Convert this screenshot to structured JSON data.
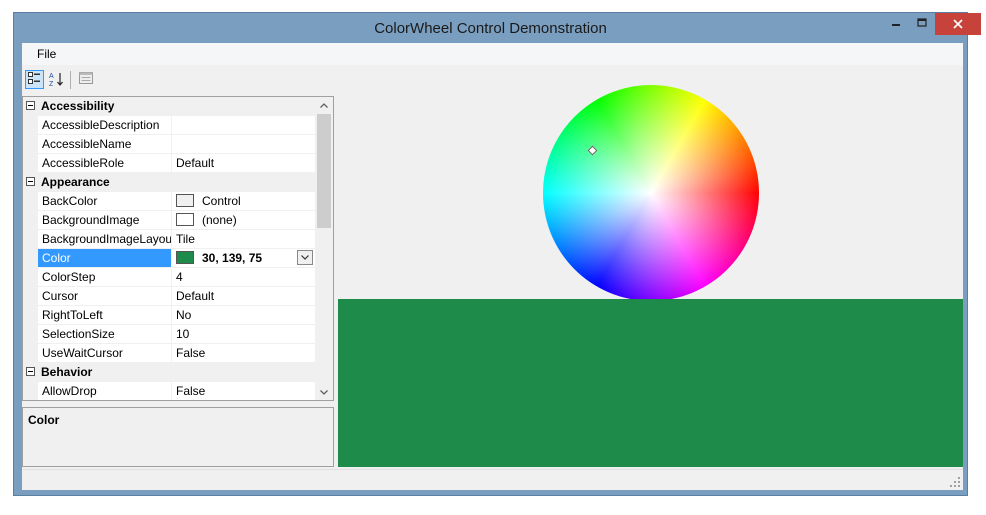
{
  "window": {
    "title": "ColorWheel Control Demonstration"
  },
  "menu": {
    "file": "File"
  },
  "property_grid": {
    "categories": {
      "accessibility": "Accessibility",
      "appearance": "Appearance",
      "behavior": "Behavior"
    },
    "rows": {
      "accessible_description": {
        "name": "AccessibleDescription",
        "value": ""
      },
      "accessible_name": {
        "name": "AccessibleName",
        "value": ""
      },
      "accessible_role": {
        "name": "AccessibleRole",
        "value": "Default"
      },
      "back_color": {
        "name": "BackColor",
        "value": "Control"
      },
      "background_image": {
        "name": "BackgroundImage",
        "value": "(none)"
      },
      "background_image_layout": {
        "name": "BackgroundImageLayout",
        "value": "Tile"
      },
      "color": {
        "name": "Color",
        "value": "30, 139, 75"
      },
      "color_step": {
        "name": "ColorStep",
        "value": "4"
      },
      "cursor": {
        "name": "Cursor",
        "value": "Default"
      },
      "right_to_left": {
        "name": "RightToLeft",
        "value": "No"
      },
      "selection_size": {
        "name": "SelectionSize",
        "value": "10"
      },
      "use_wait_cursor": {
        "name": "UseWaitCursor",
        "value": "False"
      },
      "allow_drop": {
        "name": "AllowDrop",
        "value": "False"
      }
    }
  },
  "description": {
    "title": "Color"
  },
  "colors": {
    "selected": "#1e8b4b",
    "control": "#f0f0f0",
    "background_image_swatch": "#ffffff",
    "accent": "#3399ff",
    "close": "#c7423a"
  },
  "icons": {
    "categorized": "categorized-icon",
    "alphabetical": "sort-alphabetical-icon",
    "property_pages": "property-pages-icon",
    "close": "close-icon",
    "maximize": "maximize-icon",
    "minimize": "minimize-icon"
  }
}
